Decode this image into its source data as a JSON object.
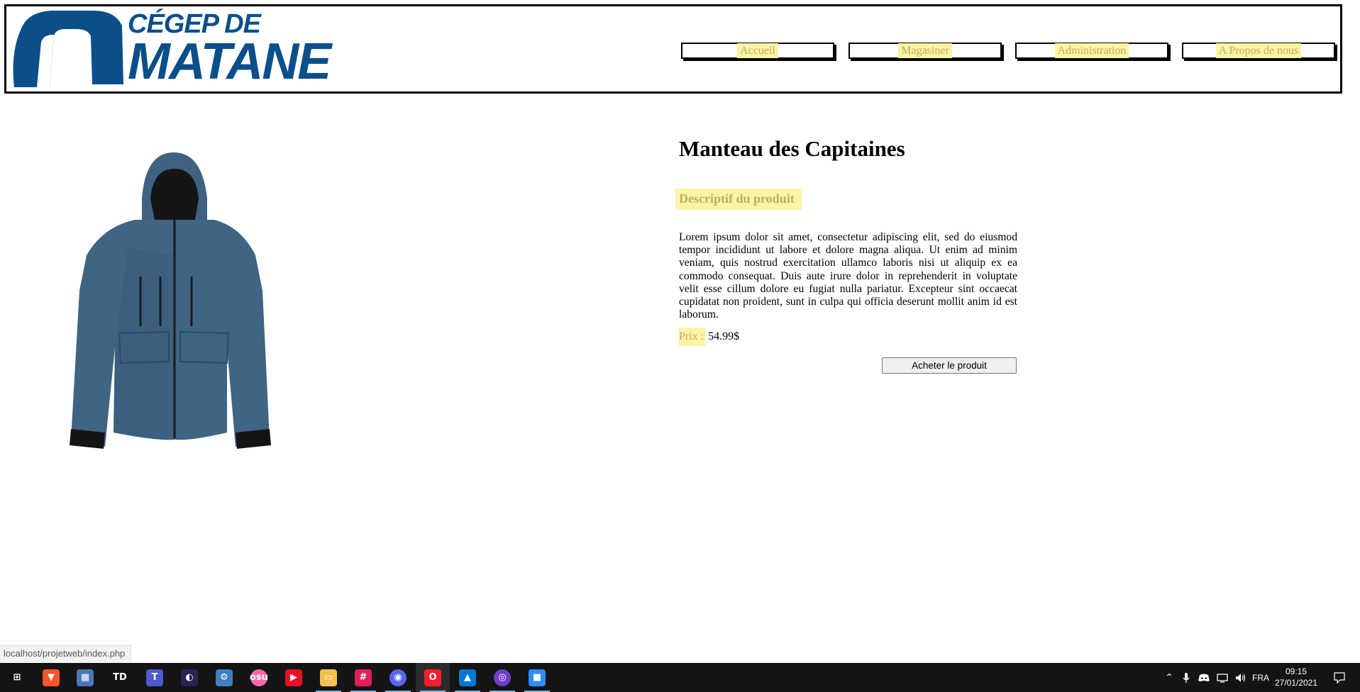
{
  "header": {
    "logo_line1": "CÉGEP DE",
    "logo_line2": "MATANE",
    "nav": [
      {
        "label": "Accueil"
      },
      {
        "label": "Magasiner"
      },
      {
        "label": "Administration"
      },
      {
        "label": "A Propos de nous"
      }
    ]
  },
  "product": {
    "title": "Manteau des Capitaines",
    "subtitle": "Descriptif du produit",
    "description": "Lorem ipsum dolor sit amet, consectetur adipiscing elit, sed do eiusmod tempor incididunt ut labore et dolore magna aliqua. Ut enim ad minim veniam, quis nostrud exercitation ullamco laboris nisi ut aliquip ex ea commodo consequat. Duis aute irure dolor in reprehenderit in voluptate velit esse cillum dolore eu fugiat nulla pariatur. Excepteur sint occaecat cupidatat non proident, sunt in culpa qui officia deserunt mollit anim id est laborum.",
    "price_label": "Prix :",
    "price_value": "54.99$",
    "buy_label": "Acheter le produit"
  },
  "status_bar": {
    "url": "localhost/projetweb/index.php"
  },
  "taskbar": {
    "apps": [
      {
        "name": "windows-start-icon",
        "glyph": "⊞",
        "color": "#ffffff"
      },
      {
        "name": "brave-icon",
        "glyph": "▼",
        "color": "#fb542b"
      },
      {
        "name": "calculator-icon",
        "glyph": "▦",
        "color": "#4a76b8"
      },
      {
        "name": "tweetdeck-icon",
        "glyph": "TD",
        "color": "#ffffff"
      },
      {
        "name": "teams-icon",
        "glyph": "T",
        "color": "#5059c9"
      },
      {
        "name": "eclipse-icon",
        "glyph": "◐",
        "color": "#2c2255"
      },
      {
        "name": "network-icon",
        "glyph": "⚙",
        "color": "#3d7fc1"
      },
      {
        "name": "osu-icon",
        "glyph": "osu",
        "color": "#ff66aa"
      },
      {
        "name": "media-player-icon",
        "glyph": "▶",
        "color": "#e81123"
      },
      {
        "name": "file-explorer-icon",
        "glyph": "▭",
        "color": "#f2c14e"
      },
      {
        "name": "slack-icon",
        "glyph": "#",
        "color": "#e01e5a"
      },
      {
        "name": "discord-icon",
        "glyph": "◉",
        "color": "#5865f2"
      },
      {
        "name": "opera-icon",
        "glyph": "O",
        "color": "#ff1b2d"
      },
      {
        "name": "photos-icon",
        "glyph": "▲",
        "color": "#0078d4"
      },
      {
        "name": "github-desktop-icon",
        "glyph": "◎",
        "color": "#6e40c9"
      },
      {
        "name": "zoom-icon",
        "glyph": "■",
        "color": "#2d8cff"
      }
    ],
    "language": "FRA",
    "time": "09:15",
    "date": "27/01/2021"
  }
}
